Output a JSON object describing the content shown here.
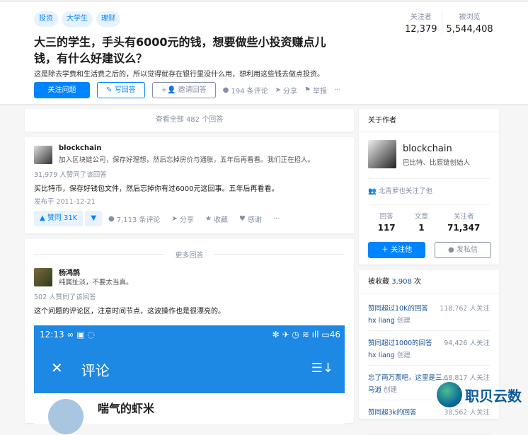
{
  "question": {
    "tags": [
      "投资",
      "大学生",
      "理财"
    ],
    "title": "大三的学生，手头有6000元的钱，想要做些小投资赚点儿钱，有什么好建议么？",
    "description": "这是除去学费和生活费之后的，所以觉得就存在银行里没什么用，想利用这些钱去做点投资。",
    "follow_btn": "关注问题",
    "write_btn": "写回答",
    "invite_btn": "邀请回答",
    "comments": "194 条评论",
    "share": "分享",
    "report": "举报",
    "more": "···",
    "followers_label": "关注者",
    "followers": "12,379",
    "views_label": "被浏览",
    "views": "5,544,408"
  },
  "view_all": "查看全部 482 个回答",
  "answer": {
    "author": "blockchain",
    "bio": "加入区块链公司，保存好理想，然后忘掉房价与通胀，五年后再看看。我们正在招人。",
    "votes_text": "31,979 人赞同了该回答",
    "content": "买比特币，保存好钱包文件，然后忘掉你有过6000元这回事。五年后再看看。",
    "date": "发布于 2011-12-21",
    "upvote": "▲ 赞同 31K",
    "downvote": "▼",
    "comments": "7,113 条评论",
    "share": "分享",
    "collect": "收藏",
    "thanks": "感谢",
    "more": "···"
  },
  "more_answers": {
    "label": "更多回答",
    "author": "杨鸿鹄",
    "bio": "纯属扯淡，不要太当真。",
    "votes_text": "502 人赞同了该回答",
    "content": "这个问题的评论区，注意时间节点，这波操作也是很漂亮的。",
    "screenshot": {
      "time": "12:13",
      "status_icons": "∞ ▣ ◌",
      "right_icons": "✻ ✈ ◷ ≋ ıll ▭46",
      "title": "评论",
      "close": "✕",
      "sort": "☰↓",
      "commenter": "喘气的虾米"
    }
  },
  "author_card": {
    "header": "关于作者",
    "name": "blockchain",
    "bio": "巴比特、比原链创始人",
    "mutual": "北青萝也关注了他",
    "stats": [
      {
        "label": "回答",
        "value": "117"
      },
      {
        "label": "文章",
        "value": "1"
      },
      {
        "label": "关注者",
        "value": "71,347"
      }
    ],
    "follow_btn": "关注他",
    "message_btn": "发私信"
  },
  "collections": {
    "header_prefix": "被收藏",
    "header_count": "3,908",
    "header_suffix": "次",
    "items": [
      {
        "title": "赞同超过10K的回答",
        "followers": "118,762 人关注",
        "creator": "hx liang",
        "created": "创建"
      },
      {
        "title": "赞同超过1000的回答",
        "followers": "94,426 人关注",
        "creator": "hx liang",
        "created": "创建"
      },
      {
        "title": "忘了两万票吧，这里是三...",
        "followers": "68,817 人关注",
        "creator": "马逍",
        "created": "创建"
      },
      {
        "title": "赞同超3k的回答",
        "followers": "38,562 人关注",
        "creator": "",
        "created": ""
      }
    ]
  },
  "watermark": "职贝云数",
  "colors": {
    "brand": "#0084ff",
    "bg": "#f6f6f6",
    "phone": "#1e88e5"
  }
}
